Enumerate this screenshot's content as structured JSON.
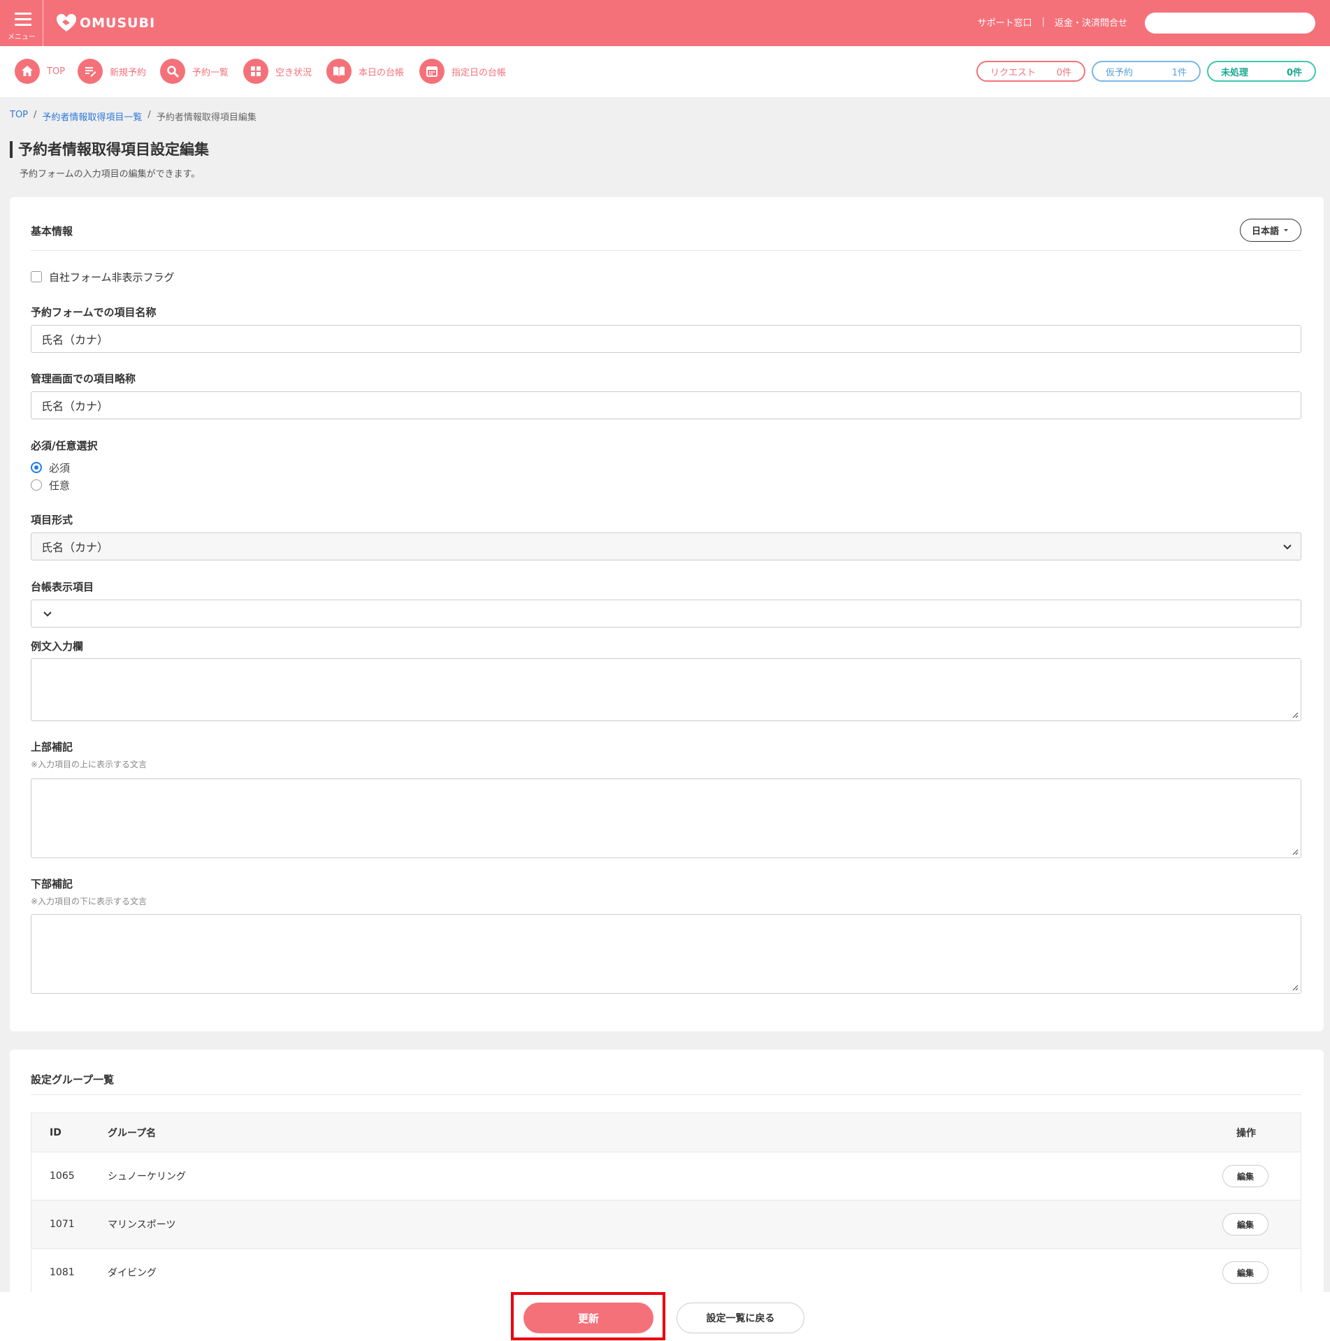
{
  "header": {
    "brand": "OMUSUBI",
    "menu_label": "メニュー",
    "links": [
      "サポート窓口",
      "返金・決済問合せ"
    ],
    "link_separator": "|",
    "search_placeholder": ""
  },
  "nav": {
    "items": [
      {
        "label": "TOP",
        "icon": "home-icon"
      },
      {
        "label": "新規予約",
        "icon": "edit-list-icon"
      },
      {
        "label": "予約一覧",
        "icon": "search-icon"
      },
      {
        "label": "空き状況",
        "icon": "grid-icon"
      },
      {
        "label": "本日の台帳",
        "icon": "book-icon"
      },
      {
        "label": "指定日の台帳",
        "icon": "calendar-icon"
      }
    ],
    "counters": [
      {
        "label": "リクエスト",
        "count": "0件"
      },
      {
        "label": "仮予約",
        "count": "1件"
      },
      {
        "label": "未処理",
        "count": "0件"
      }
    ]
  },
  "breadcrumb": {
    "items": [
      "TOP",
      "予約者情報取得項目一覧",
      "予約者情報取得項目編集"
    ],
    "separator": "/"
  },
  "page": {
    "title": "予約者情報取得項目設定編集",
    "subtitle": "予約フォームの入力項目の編集ができます。"
  },
  "basic_info": {
    "section_title": "基本情報",
    "language_button": "日本語",
    "hide_flag_label": "自社フォーム非表示フラグ",
    "hide_flag_checked": false,
    "form_item_name": {
      "label": "予約フォームでの項目名称",
      "value": "氏名（カナ）"
    },
    "admin_item_name": {
      "label": "管理画面での項目略称",
      "value": "氏名（カナ）"
    },
    "required": {
      "label": "必須/任意選択",
      "options": [
        "必須",
        "任意"
      ],
      "selected": "必須"
    },
    "item_format": {
      "label": "項目形式",
      "value": "氏名（カナ）"
    },
    "ledger_item": {
      "label": "台帳表示項目",
      "value": ""
    },
    "example_text": {
      "label": "例文入力欄",
      "value": ""
    },
    "top_note": {
      "label": "上部補記",
      "hint": "※入力項目の上に表示する文言",
      "value": ""
    },
    "bottom_note": {
      "label": "下部補記",
      "hint": "※入力項目の下に表示する文言",
      "value": ""
    }
  },
  "groups": {
    "section_title": "設定グループ一覧",
    "columns": [
      "ID",
      "グループ名",
      "操作"
    ],
    "rows": [
      {
        "id": "1065",
        "name": "シュノーケリング",
        "action": "編集"
      },
      {
        "id": "1071",
        "name": "マリンスポーツ",
        "action": "編集"
      },
      {
        "id": "1081",
        "name": "ダイビング",
        "action": "編集"
      }
    ]
  },
  "footer": {
    "update_button": "更新",
    "back_button": "設定一覧に戻る"
  },
  "colors": {
    "brand": "#f5717a",
    "link": "#2f7ad9",
    "pending": "#5aa0da",
    "unprocessed": "#18a88d",
    "highlight": "#e8000d"
  }
}
